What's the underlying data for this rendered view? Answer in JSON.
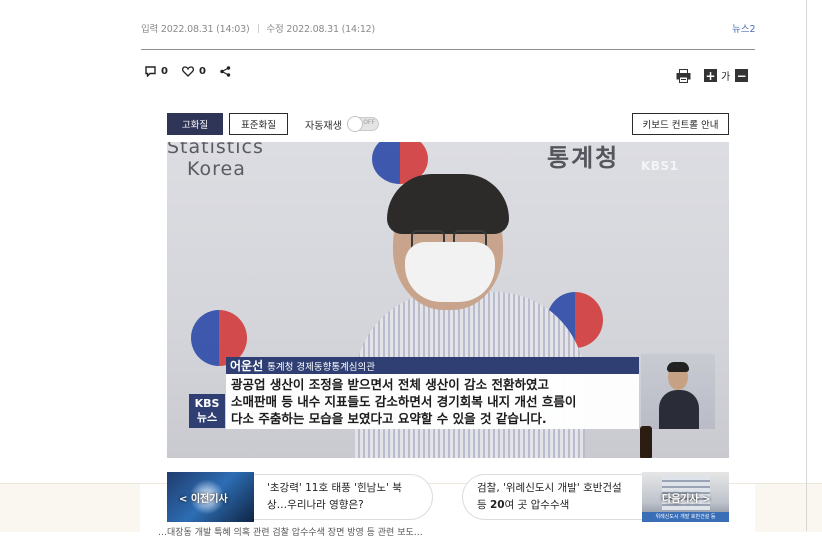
{
  "article": {
    "meta": {
      "input_label": "입력 2022.08.31 (14:03)",
      "modified_label": "수정 2022.08.31 (14:12)",
      "source": "뉴스2"
    },
    "actions": {
      "comments": "0",
      "likes": "0"
    },
    "tools": {
      "font_label": "가"
    }
  },
  "player": {
    "quality_high": "고화질",
    "quality_std": "표준화질",
    "autoplay_label": "자동재생",
    "autoplay_state": "OFF",
    "keyboard_help": "키보드 컨트롤 안내",
    "frame": {
      "watermark_line1": "Statistics",
      "watermark_line2": "Korea",
      "watermark_agency": "통계청",
      "broadcaster_bug": "KBS1",
      "speaker_name": "어운선",
      "speaker_title": "통계청 경제동향통계심의관",
      "caption_lines": [
        "광공업 생산이 조정을 받으면서 전체 생산이 감소 전환하였고",
        "소매판매 등 내수 지표들도 감소하면서 경기회복 내지 개선 흐름이",
        "다소 주춤하는 모습을 보였다고 요약할 수 있을 것 같습니다."
      ],
      "news_logo_top": "KBS",
      "news_logo_bottom": "뉴스"
    }
  },
  "navigation": {
    "prev": {
      "label": "< 이전기사",
      "title_normal": "'초강력' 11호 태풍 '힌남노' 북상…우리나라 영향은?"
    },
    "next": {
      "label": "다음기사 >",
      "title_prefix": "검찰, '위례신도시 개발' 호반건설 등 ",
      "title_bold": "20",
      "title_suffix": "여 곳 압수수색",
      "thumb_banner": "위례신도시 개발 호반건설 등"
    }
  },
  "cut_text": "…대장동 개발 특혜 의혹 관련 검찰 압수수색 장면 방영 등 관련 보도…"
}
